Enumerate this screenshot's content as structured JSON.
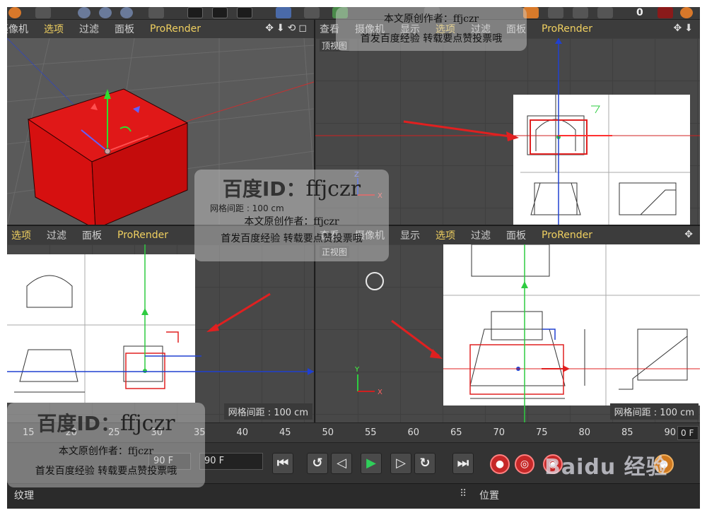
{
  "viewport_menu": {
    "view": "查看",
    "camera": "摄像机",
    "display": "显示",
    "options": "选项",
    "filter": "过滤",
    "panel": "面板",
    "prorender": "ProRender"
  },
  "viewport_tl": {
    "name": ""
  },
  "viewport_tr": {
    "name": "顶视图",
    "grid_note": ""
  },
  "viewport_bl": {
    "grid_note": "网格间距 : 100 cm"
  },
  "viewport_br": {
    "name": "正视图",
    "grid_note": "网格间距 : 100 cm"
  },
  "center_note": "网格间距 : 100 cm",
  "toolbar": {
    "counter": "0"
  },
  "timeline": {
    "ticks": [
      "15",
      "20",
      "25",
      "30",
      "35",
      "40",
      "45",
      "50",
      "55",
      "60",
      "65",
      "70",
      "75",
      "80",
      "85",
      "90"
    ],
    "current_frame": "0 F"
  },
  "transport": {
    "start_field": "90 F",
    "end_field": "90 F"
  },
  "bottom_panels": {
    "left_title": "纹理",
    "right_title": "位置"
  },
  "watermark": {
    "id_label": "百度ID：",
    "id_value": "ffjczr",
    "author_line": "本文原创作者：ffjczr",
    "publish_line": "首发百度经验  转载要点赞投票哦",
    "baidu_brand": "Baidu 经验"
  },
  "colors": {
    "accent_yellow": "#f0d060",
    "annotation_red": "#e02020",
    "cube_red": "#e01010",
    "play_green": "#2fcf5a"
  },
  "icons": [
    "move-icon",
    "arrow-down-icon",
    "rotate-icon",
    "maximize-icon",
    "play-icon",
    "record-icon"
  ]
}
